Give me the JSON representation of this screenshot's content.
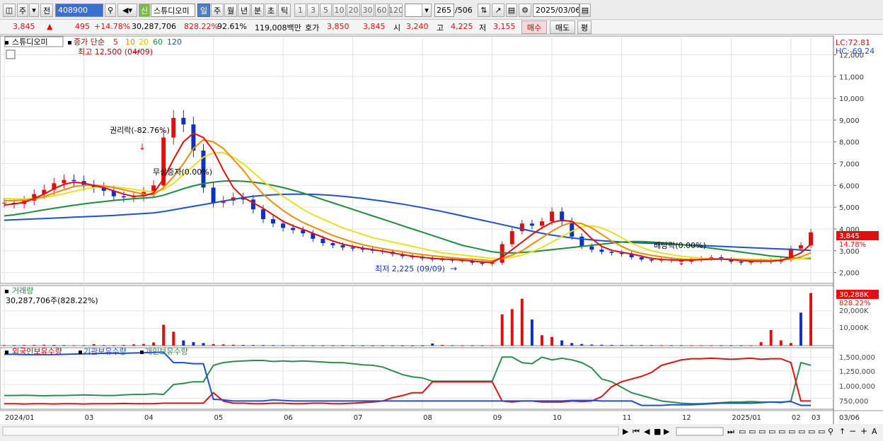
{
  "toolbar": {
    "market": "주",
    "type": "전",
    "code": "408900",
    "new_badge": "신",
    "name": "스튜디오미",
    "periods": [
      "일",
      "주",
      "월",
      "년",
      "분",
      "초",
      "틱"
    ],
    "active_period": "일",
    "intervals": [
      "1",
      "3",
      "5",
      "10",
      "20",
      "30",
      "60",
      "120"
    ],
    "count": "265",
    "total": "/506",
    "date": "2025/03/06"
  },
  "quote": {
    "price": "3,845",
    "arrow": "▲",
    "change": "495",
    "pct": "+14.78%",
    "volume": "30,287,706",
    "vol_ratio": "828.22%",
    "turnover_ratio": "92.61%",
    "amount": "119,008백만",
    "bid_label": "호가",
    "bid": "3,850",
    "ask": "3,845",
    "open_label": "시",
    "open": "3,240",
    "high_label": "고",
    "high": "4,225",
    "low_label": "저",
    "low": "3,155",
    "buy_button": "매수",
    "sell_button": "매도",
    "eval_button": "평"
  },
  "colors": {
    "ma5": "#e01010",
    "ma10": "#f08c00",
    "ma20": "#e8e020",
    "ma60": "#1e8c3c",
    "ma120": "#2050d0",
    "up": "#e01010",
    "down": "#1030c0",
    "foreign": "#e01010",
    "institution": "#2050d0",
    "individual": "#2e8c50"
  },
  "chart_data": [
    {
      "type": "line",
      "title": "스튜디오미",
      "subtitle": "종가 단순",
      "legend": [
        "5",
        "10",
        "20",
        "60",
        "120"
      ],
      "x_ticks": [
        "2024/01",
        "03",
        "04",
        "05",
        "06",
        "07",
        "08",
        "09",
        "10",
        "11",
        "12",
        "2025/01",
        "02",
        "03",
        "03/06"
      ],
      "y_ticks": [
        2000,
        3000,
        4000,
        5000,
        6000,
        7000,
        8000,
        9000,
        10000,
        11000,
        12000
      ],
      "ylim": [
        1500,
        12600
      ],
      "lc_label": "LC:72.81",
      "hc_label": "HC:-69.24",
      "last_price_label": "3,845",
      "last_pct_label": "14.78%",
      "annotations": {
        "high": "최고 12,500 (04/09)",
        "low": "최저 2,225 (09/09)",
        "rights": "권리락(-82.76%)",
        "bonus": "무상증자(0.00%)",
        "dividend": "배당락(0.00%)"
      },
      "close": [
        5200,
        5150,
        5300,
        5600,
        5800,
        6100,
        6250,
        6200,
        6000,
        5900,
        5750,
        5500,
        5450,
        5500,
        5700,
        6000,
        8200,
        9100,
        8800,
        7600,
        5900,
        5200,
        5300,
        5450,
        5350,
        4900,
        4450,
        4250,
        4050,
        3950,
        3800,
        3550,
        3350,
        3250,
        3150,
        3100,
        3050,
        3000,
        2950,
        2850,
        2750,
        2700,
        2650,
        2600,
        2600,
        2550,
        2550,
        2450,
        2400,
        2450,
        3300,
        3900,
        4250,
        4150,
        4350,
        4800,
        4350,
        3650,
        3200,
        3050,
        2950,
        2900,
        2850,
        2700,
        2600,
        2550,
        2600,
        2550,
        2500,
        2600,
        2650,
        2700,
        2600,
        2500,
        2450,
        2500,
        2550,
        2500,
        2600,
        3100,
        3250,
        3845
      ],
      "ma5": [
        5100,
        5150,
        5220,
        5400,
        5600,
        5850,
        6050,
        6150,
        6100,
        6000,
        5900,
        5750,
        5600,
        5500,
        5520,
        5650,
        6300,
        7200,
        8000,
        8400,
        8200,
        7600,
        6700,
        5900,
        5450,
        5200,
        4950,
        4650,
        4350,
        4150,
        3980,
        3800,
        3620,
        3450,
        3300,
        3200,
        3120,
        3050,
        2980,
        2900,
        2820,
        2750,
        2700,
        2650,
        2620,
        2600,
        2570,
        2530,
        2480,
        2460,
        2700,
        3050,
        3400,
        3750,
        4050,
        4300,
        4400,
        4350,
        4000,
        3550,
        3200,
        3020,
        2930,
        2850,
        2750,
        2650,
        2600,
        2580,
        2560,
        2570,
        2590,
        2620,
        2620,
        2590,
        2550,
        2520,
        2520,
        2520,
        2560,
        2700,
        2900,
        3300
      ],
      "ma10": [
        5300,
        5300,
        5320,
        5380,
        5480,
        5650,
        5800,
        5950,
        6000,
        6020,
        5980,
        5900,
        5800,
        5700,
        5600,
        5580,
        5900,
        6400,
        7000,
        7700,
        8100,
        8000,
        7700,
        7200,
        6700,
        6100,
        5600,
        5200,
        4850,
        4550,
        4300,
        4100,
        3900,
        3700,
        3550,
        3400,
        3280,
        3180,
        3100,
        3020,
        2950,
        2880,
        2820,
        2770,
        2720,
        2680,
        2640,
        2610,
        2580,
        2540,
        2650,
        2800,
        3000,
        3300,
        3600,
        3900,
        4150,
        4300,
        4250,
        4050,
        3750,
        3450,
        3200,
        3000,
        2880,
        2790,
        2720,
        2660,
        2620,
        2600,
        2590,
        2600,
        2610,
        2610,
        2590,
        2570,
        2560,
        2550,
        2560,
        2620,
        2720,
        2900
      ],
      "ma20": [
        5400,
        5380,
        5380,
        5400,
        5450,
        5520,
        5620,
        5730,
        5830,
        5900,
        5930,
        5920,
        5880,
        5820,
        5760,
        5700,
        5800,
        6100,
        6500,
        6900,
        7300,
        7500,
        7500,
        7300,
        7000,
        6600,
        6200,
        5850,
        5500,
        5200,
        4900,
        4650,
        4450,
        4250,
        4050,
        3900,
        3750,
        3600,
        3500,
        3400,
        3300,
        3200,
        3100,
        3000,
        2900,
        2850,
        2800,
        2750,
        2700,
        2650,
        2650,
        2700,
        2800,
        2950,
        3150,
        3400,
        3650,
        3900,
        4100,
        4150,
        4050,
        3850,
        3600,
        3350,
        3150,
        3000,
        2900,
        2820,
        2750,
        2700,
        2660,
        2640,
        2630,
        2630,
        2620,
        2610,
        2600,
        2590,
        2590,
        2600,
        2640,
        2700
      ],
      "ma60": [
        4600,
        4650,
        4720,
        4800,
        4880,
        4950,
        5020,
        5090,
        5150,
        5210,
        5260,
        5310,
        5350,
        5390,
        5420,
        5450,
        5550,
        5700,
        5850,
        5980,
        6080,
        6150,
        6200,
        6210,
        6190,
        6150,
        6090,
        6000,
        5900,
        5780,
        5650,
        5500,
        5350,
        5200,
        5050,
        4900,
        4750,
        4600,
        4450,
        4300,
        4150,
        4000,
        3850,
        3700,
        3550,
        3400,
        3250,
        3150,
        3050,
        2950,
        2900,
        2900,
        2920,
        2950,
        3000,
        3050,
        3100,
        3150,
        3200,
        3250,
        3300,
        3350,
        3400,
        3420,
        3420,
        3400,
        3370,
        3330,
        3280,
        3230,
        3180,
        3120,
        3060,
        3000,
        2940,
        2880,
        2820,
        2760,
        2720,
        2680,
        2650,
        2650
      ],
      "ma120": [
        4400,
        4420,
        4440,
        4460,
        4480,
        4500,
        4520,
        4540,
        4560,
        4580,
        4600,
        4620,
        4650,
        4680,
        4710,
        4740,
        4800,
        4880,
        4960,
        5040,
        5120,
        5200,
        5280,
        5360,
        5440,
        5500,
        5540,
        5570,
        5590,
        5600,
        5600,
        5590,
        5570,
        5540,
        5500,
        5450,
        5400,
        5340,
        5280,
        5210,
        5140,
        5060,
        4980,
        4890,
        4800,
        4700,
        4600,
        4500,
        4400,
        4300,
        4200,
        4100,
        4000,
        3900,
        3800,
        3720,
        3650,
        3590,
        3540,
        3500,
        3460,
        3430,
        3400,
        3380,
        3360,
        3340,
        3320,
        3300,
        3280,
        3260,
        3240,
        3220,
        3200,
        3180,
        3160,
        3140,
        3120,
        3100,
        3080,
        3060,
        3040,
        3020
      ]
    },
    {
      "type": "bar",
      "title": "거래량",
      "subtitle": "30,287,706주(828.22%)",
      "y_ticks": [
        "10,000K",
        "20,000K"
      ],
      "last_label": "30,288K",
      "last_pct_label": "828.22%",
      "values": [
        300,
        250,
        350,
        400,
        500,
        380,
        300,
        260,
        240,
        800,
        300,
        250,
        400,
        700,
        900,
        1800,
        12000,
        8000,
        3000,
        2000,
        1500,
        900,
        700,
        500,
        400,
        350,
        300,
        250,
        220,
        200,
        180,
        170,
        160,
        150,
        140,
        130,
        130,
        120,
        120,
        110,
        110,
        100,
        100,
        1200,
        400,
        200,
        150,
        150,
        140,
        200,
        18000,
        21000,
        27000,
        15000,
        6000,
        5000,
        3000,
        1500,
        900,
        600,
        500,
        400,
        350,
        300,
        280,
        260,
        240,
        220,
        200,
        200,
        190,
        180,
        170,
        170,
        160,
        160,
        2000,
        9000,
        3000,
        1500,
        19000,
        30288
      ],
      "up": [
        1,
        0,
        1,
        1,
        1,
        0,
        0,
        1,
        0,
        1,
        0,
        0,
        1,
        1,
        1,
        1,
        1,
        1,
        0,
        0,
        0,
        1,
        1,
        1,
        0,
        0,
        0,
        0,
        0,
        0,
        0,
        0,
        0,
        0,
        0,
        0,
        0,
        0,
        0,
        0,
        0,
        0,
        0,
        0,
        1,
        0,
        1,
        0,
        0,
        1,
        1,
        1,
        1,
        0,
        1,
        1,
        0,
        0,
        0,
        0,
        0,
        0,
        0,
        0,
        0,
        0,
        1,
        0,
        0,
        1,
        1,
        1,
        0,
        0,
        0,
        1,
        1,
        1,
        1,
        1,
        0,
        1
      ]
    },
    {
      "type": "line",
      "series_names": [
        "외국인보유수량",
        "기관보유수량",
        "개인보유수량"
      ],
      "y_ticks": [
        "750,000",
        "1,000,000",
        "1,250,000",
        "1,500,000"
      ],
      "ylim": [
        550000,
        1620000
      ],
      "foreign": [
        650000,
        650000,
        645000,
        650000,
        650000,
        645000,
        650000,
        650000,
        645000,
        650000,
        650000,
        650000,
        655000,
        650000,
        650000,
        650000,
        660000,
        660000,
        660000,
        660000,
        660000,
        850000,
        700000,
        660000,
        660000,
        650000,
        650000,
        660000,
        660000,
        650000,
        650000,
        660000,
        660000,
        650000,
        650000,
        660000,
        670000,
        680000,
        700000,
        760000,
        800000,
        850000,
        850000,
        1050000,
        1050000,
        1050000,
        1050000,
        1050000,
        1050000,
        1050000,
        700000,
        680000,
        700000,
        700000,
        680000,
        680000,
        680000,
        700000,
        690000,
        700000,
        780000,
        960000,
        1050000,
        1100000,
        1150000,
        1220000,
        1350000,
        1400000,
        1450000,
        1470000,
        1470000,
        1480000,
        1470000,
        1460000,
        1470000,
        1480000,
        1460000,
        1470000,
        1470000,
        1400000,
        700000,
        700000
      ],
      "institution": [
        1550000,
        1550000,
        1545000,
        1545000,
        1545000,
        1545000,
        1550000,
        1555000,
        1560000,
        1565000,
        1570000,
        1570000,
        1570000,
        1575000,
        1580000,
        1585000,
        1590000,
        1400000,
        1400000,
        1380000,
        1380000,
        730000,
        720000,
        700000,
        700000,
        700000,
        700000,
        720000,
        710000,
        700000,
        700000,
        700000,
        700000,
        700000,
        700000,
        700000,
        700000,
        700000,
        700000,
        700000,
        700000,
        700000,
        700000,
        700000,
        700000,
        700000,
        700000,
        700000,
        700000,
        700000,
        700000,
        700000,
        700000,
        700000,
        700000,
        700000,
        700000,
        710000,
        710000,
        710000,
        700000,
        700000,
        700000,
        700000,
        620000,
        620000,
        620000,
        630000,
        630000,
        630000,
        640000,
        650000,
        660000,
        660000,
        660000,
        660000,
        670000,
        680000,
        680000,
        690000,
        620000,
        620000
      ],
      "individual": [
        800000,
        800000,
        805000,
        800000,
        795000,
        800000,
        800000,
        805000,
        810000,
        805000,
        800000,
        800000,
        810000,
        820000,
        820000,
        830000,
        820000,
        1000000,
        1020000,
        1050000,
        1050000,
        1350000,
        1400000,
        1420000,
        1430000,
        1440000,
        1440000,
        1420000,
        1430000,
        1420000,
        1430000,
        1420000,
        1410000,
        1400000,
        1400000,
        1380000,
        1360000,
        1350000,
        1320000,
        1250000,
        1180000,
        1140000,
        1120000,
        1060000,
        1060000,
        1060000,
        1060000,
        1060000,
        1060000,
        1060000,
        1500000,
        1500000,
        1400000,
        1380000,
        1500000,
        1450000,
        1480000,
        1450000,
        1400000,
        1300000,
        1100000,
        1050000,
        950000,
        850000,
        800000,
        750000,
        700000,
        680000,
        660000,
        650000,
        650000,
        660000,
        670000,
        680000,
        680000,
        690000,
        680000,
        680000,
        670000,
        700000,
        1400000,
        1350000
      ]
    }
  ],
  "bottom": {
    "nav_icons": [
      "▶",
      "⏮",
      "◀",
      "■",
      "▶",
      "⏭"
    ],
    "zoom": [
      "−",
      "+",
      "A"
    ]
  }
}
